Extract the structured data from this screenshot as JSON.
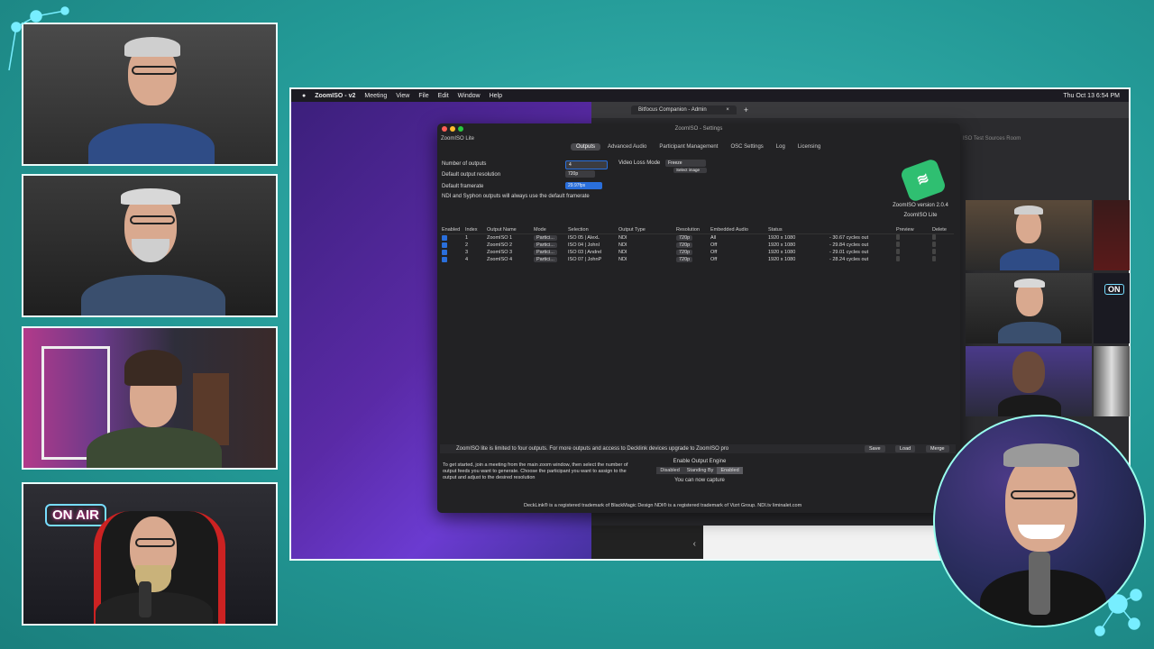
{
  "screen": {
    "menubar": {
      "apple": "",
      "app_name": "ZoomISO - v2",
      "items": [
        "Meeting",
        "View",
        "File",
        "Edit",
        "Window",
        "Help"
      ],
      "clock": "Thu Oct 13  6:54 PM"
    },
    "browser": {
      "tab_title": "Bitfocus Companion - Admin",
      "close_glyph": "×",
      "new_tab_glyph": "+",
      "side_text": "ISO Test Sources Room",
      "back_glyph": "‹"
    },
    "settings": {
      "window_title": "ZoomISO - Settings",
      "app_title": "ZoomISO Lite",
      "tabs": [
        {
          "label": "Outputs",
          "active": true
        },
        {
          "label": "Advanced Audio",
          "active": false
        },
        {
          "label": "Participant Management",
          "active": false
        },
        {
          "label": "OSC Settings",
          "active": false
        },
        {
          "label": "Log",
          "active": false
        },
        {
          "label": "Licensing",
          "active": false
        }
      ],
      "fields": {
        "num_outputs_label": "Number of outputs",
        "num_outputs_value": "4",
        "video_loss_label": "Video Loss Mode",
        "video_loss_value": "Freeze",
        "select_image_label": "Select image",
        "default_res_label": "Default output resolution",
        "default_res_value": "720p",
        "default_fps_label": "Default framerate",
        "default_fps_value": "29.97fps",
        "ndi_note": "NDI and Syphon outputs will always use the default framerate"
      },
      "version_lines": [
        "ZoomISO version 2.0.4",
        "ZoomISO Lite"
      ],
      "table": {
        "headers": [
          "Enabled",
          "Index",
          "Output Name",
          "Mode",
          "Selection",
          "Output Type",
          "Resolution",
          "Embedded Audio",
          "Status",
          "",
          "Preview",
          "Delete"
        ],
        "rows": [
          {
            "index": "1",
            "name": "ZoomISO 1",
            "mode": "Partici...",
            "selection": "ISO 05 | AlexL",
            "type": "NDI",
            "res": "720p",
            "audio": "All",
            "status": "1920 x 1080",
            "cycles": "- 30.67 cycles out"
          },
          {
            "index": "2",
            "name": "ZoomISO 2",
            "mode": "Partici...",
            "selection": "ISO 04 | JohnI",
            "type": "NDI",
            "res": "720p",
            "audio": "Off",
            "status": "1920 x 1080",
            "cycles": "- 29.84 cycles out"
          },
          {
            "index": "3",
            "name": "ZoomISO 3",
            "mode": "Partici...",
            "selection": "ISO 03 | AndreI",
            "type": "NDI",
            "res": "720p",
            "audio": "Off",
            "status": "1920 x 1080",
            "cycles": "- 29.01 cycles out"
          },
          {
            "index": "4",
            "name": "ZoomISO 4",
            "mode": "Partici...",
            "selection": "ISO 07 | JohnP",
            "type": "NDI",
            "res": "720p",
            "audio": "Off",
            "status": "1920 x 1080",
            "cycles": "- 28.24 cycles out"
          }
        ]
      },
      "footer": {
        "limit_text": "ZoomISO lite is limited to four outputs. For more outputs and access to Decklink devices upgrade to ZoomISO pro",
        "save": "Save",
        "load": "Load",
        "merge": "Merge",
        "intro": "To get started, join a meeting from the main zoom window, then select the number of output feeds you want to generate. Choose the participant you want to assign to the output and adjust to the desired resolution",
        "engine_title": "Enable Output Engine",
        "engine_options": [
          {
            "label": "Disabled",
            "selected": false
          },
          {
            "label": "Standing By",
            "selected": false
          },
          {
            "label": "Enabled",
            "selected": true
          }
        ],
        "engine_status": "You can now capture",
        "trademark": "DeckLink® is a registered trademark of BlackMagic Design   NDI® is a registered trademark of Vizrt Group.     NDI.tv     liminalet.com"
      }
    }
  },
  "overlays": {
    "on_air_sign": "ON AIR",
    "small_on_sign": "ON"
  },
  "colors": {
    "background": "#239996",
    "frame_border": "#e9fbfa",
    "accent_blue": "#2a6fdb",
    "zoomiso_green": "#2fbf71"
  }
}
